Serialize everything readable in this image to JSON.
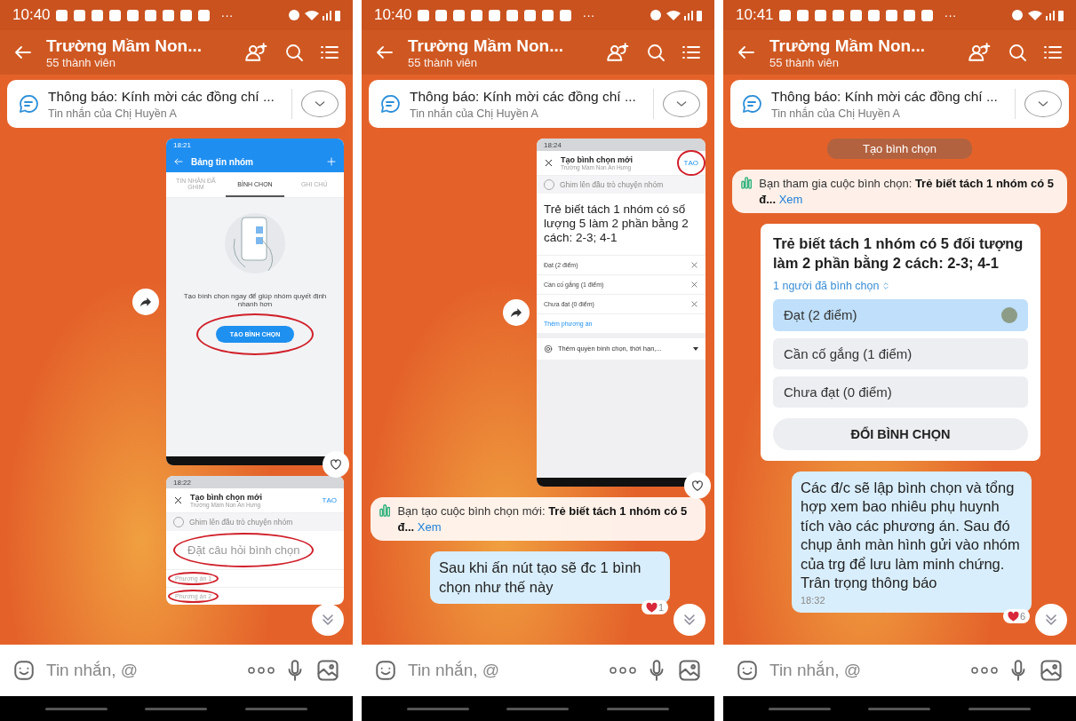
{
  "phones": [
    {
      "status": {
        "time": "10:40",
        "more": "···"
      },
      "header": {
        "title": "Trường Mầm Non...",
        "subtitle": "55 thành viên"
      },
      "pinned": {
        "title": "Thông báo: Kính mời các đồng chí ...",
        "subtitle": "Tin nhắn của Chị Huyền A"
      },
      "messages": [
        {
          "kind": "screenshot_board",
          "status_time": "18:21",
          "title": "Bảng tin nhóm",
          "tabs": [
            {
              "label": "TIN NHẮN ĐÃ GHIM",
              "selected": false
            },
            {
              "label": "BÌNH CHỌN",
              "selected": true
            },
            {
              "label": "GHI CHÚ",
              "selected": false
            }
          ],
          "hint": "Tạo bình chọn ngay để giúp nhóm quyết định nhanh hơn",
          "button": "TẠO BÌNH CHỌN"
        },
        {
          "kind": "screenshot_create",
          "status_time": "18:22",
          "title": "Tạo bình chọn mới",
          "subtitle": "Trường Mầm Non An Hưng",
          "action": "TẠO",
          "pin_checked": false,
          "pin_label": "Ghim lên đầu trò chuyện nhóm",
          "question_placeholder": "Đặt câu hỏi bình chọn",
          "options": [
            {
              "placeholder": "Phương án 1"
            },
            {
              "placeholder": "Phương án 2"
            }
          ]
        }
      ],
      "input_placeholder": "Tin nhắn, @"
    },
    {
      "status": {
        "time": "10:40",
        "more": "···"
      },
      "header": {
        "title": "Trường Mầm Non...",
        "subtitle": "55 thành viên"
      },
      "pinned": {
        "title": "Thông báo: Kính mời các đồng chí ...",
        "subtitle": "Tin nhắn của Chị Huyền A"
      },
      "messages": [
        {
          "kind": "screenshot_create",
          "status_time": "18:24",
          "title": "Tạo bình chọn mới",
          "subtitle": "Trường Mầm Non An Hưng",
          "action": "TẠO",
          "pin_checked": false,
          "pin_label": "Ghim lên đầu trò chuyện nhóm",
          "question": "Trẻ biết tách 1 nhóm có số lượng 5 làm 2 phần bằng 2 cách: 2-3; 4-1",
          "options": [
            {
              "text": "Đạt (2 điểm)"
            },
            {
              "text": "Cần cố gắng (1 điểm)"
            },
            {
              "text": "Chưa đạt (0 điểm)"
            }
          ],
          "add_option": "Thêm phương án",
          "settings": "Thêm quyền bình chọn, thời hạn,..."
        },
        {
          "kind": "poll_notice",
          "text": "Bạn tạo cuộc bình chọn mới: **Trẻ biết tách 1 nhóm có 5 đ...**",
          "link": "Xem"
        },
        {
          "kind": "text",
          "text": "Sau khi ấn nút tạo sẽ đc 1 bình chọn như thế này",
          "reaction_count": "1"
        }
      ],
      "input_placeholder": "Tin nhắn, @"
    },
    {
      "status": {
        "time": "10:41",
        "more": "···"
      },
      "header": {
        "title": "Trường Mầm Non...",
        "subtitle": "55 thành viên"
      },
      "pinned": {
        "title": "Thông báo: Kính mời các đồng chí ...",
        "subtitle": "Tin nhắn của Chị Huyền A"
      },
      "messages": [
        {
          "kind": "system",
          "text": "Tạo bình chọn"
        },
        {
          "kind": "poll_notice",
          "text": "Bạn tham gia cuộc bình chọn: **Trẻ biết tách 1 nhóm có 5 đ...**",
          "link": "Xem"
        },
        {
          "kind": "poll",
          "question": "Trẻ biết tách 1 nhóm có 5 đối tượng làm 2 phần bằng 2 cách: 2-3; 4-1",
          "voters": "1 người đã bình chọn",
          "options": [
            {
              "label": "Đạt (2 điểm)",
              "selected": true
            },
            {
              "label": "Cần cố gắng (1 điểm)",
              "selected": false
            },
            {
              "label": "Chưa đạt (0 điểm)",
              "selected": false
            }
          ],
          "button": "ĐỔI BÌNH CHỌN"
        },
        {
          "kind": "text",
          "text": "Các đ/c sẽ lập bình chọn và tổng hợp xem bao nhiêu phụ huynh tích vào các phương án. Sau đó chụp ảnh màn hình gửi vào nhóm của trg để lưu làm minh chứng. Trân trọng thông báo",
          "time": "18:32",
          "reaction_count": "6"
        }
      ],
      "input_placeholder": "Tin nhắn, @"
    }
  ]
}
